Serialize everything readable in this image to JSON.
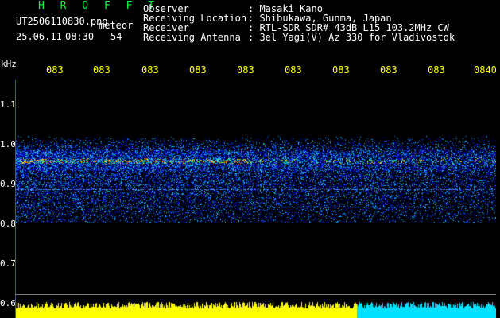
{
  "logo": {
    "text": "H R O F F T",
    "color": "#00ff40"
  },
  "file": {
    "name": "UT2506110830.png",
    "tag": "meteor"
  },
  "datetime": {
    "date": "25.06.11",
    "time": "08:30",
    "count": "54"
  },
  "info": {
    "labels": [
      "Observer",
      "Receiving Location",
      "Receiver",
      "Receiving Antenna"
    ],
    "values": [
      ": Masaki Kano",
      ": Shibukawa, Gunma, Japan",
      ": RTL-SDR SDR# 43dB L15 103.2MHz CW",
      ": 3el Yagi(V) Az 330 for Vladivostok"
    ]
  },
  "axis": {
    "unit": "kHz",
    "x_ticks": [
      "083",
      "083",
      "083",
      "083",
      "083",
      "083",
      "083",
      "083",
      "083",
      "0840"
    ],
    "y_ticks": [
      "1.1",
      "1.0",
      "0.9",
      "0.8",
      "0.7",
      "0.6"
    ]
  },
  "colors": {
    "spectrum_low": "#000080",
    "spectrum_mid": "#0080ff",
    "spectrum_high": "#ff2000",
    "level_bar": "#ffff00",
    "level_bar_late": "#00e0ff"
  }
}
